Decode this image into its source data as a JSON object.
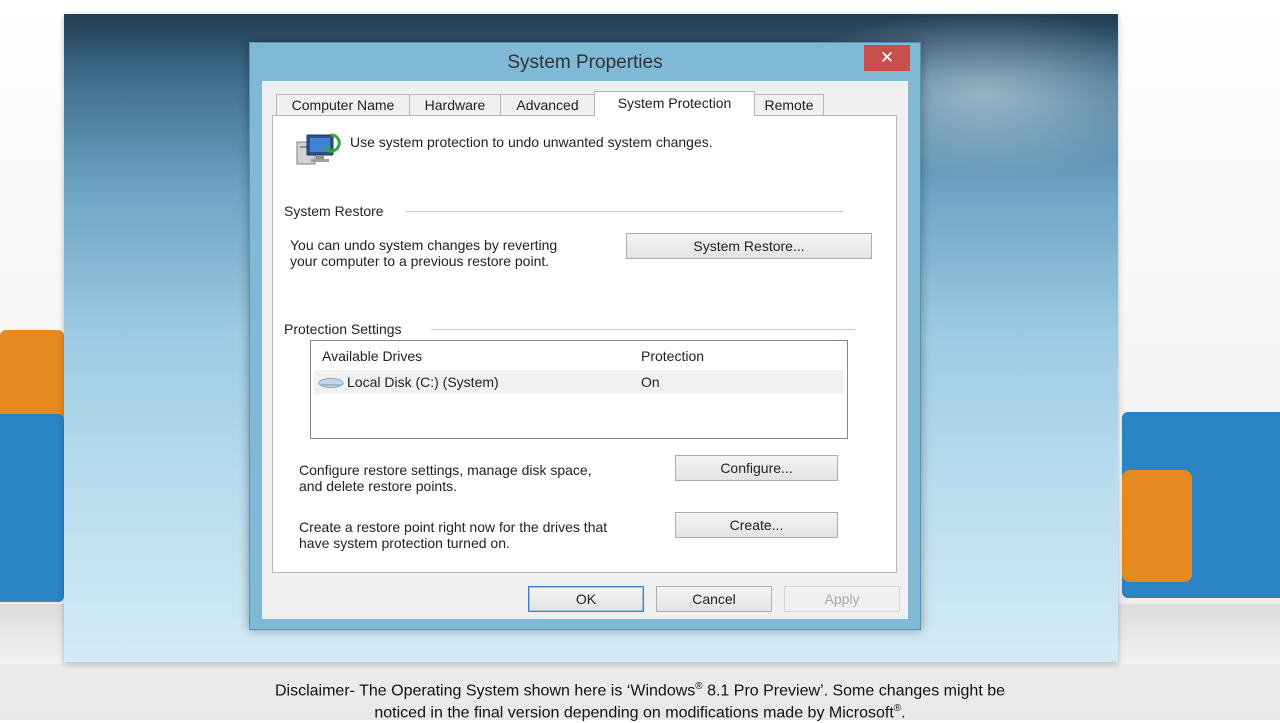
{
  "window": {
    "title": "System Properties",
    "close_glyph": "✕"
  },
  "tabs": [
    {
      "label": "Computer Name"
    },
    {
      "label": "Hardware"
    },
    {
      "label": "Advanced"
    },
    {
      "label": "System Protection",
      "active": true
    },
    {
      "label": "Remote"
    }
  ],
  "intro": {
    "icon": "system-protection-icon",
    "text": "Use system protection to undo unwanted system changes."
  },
  "system_restore": {
    "heading": "System Restore",
    "description_line1": "You can undo system changes by reverting",
    "description_line2": "your computer to a previous restore point.",
    "button_label": "System Restore..."
  },
  "protection_settings": {
    "heading": "Protection Settings",
    "columns": [
      "Available Drives",
      "Protection"
    ],
    "drives": [
      {
        "icon": "drive-icon",
        "name": "Local Disk (C:) (System)",
        "protection": "On"
      }
    ],
    "configure_line1": "Configure restore settings, manage disk space,",
    "configure_line2": "and delete restore points.",
    "configure_label": "Configure...",
    "create_line1": "Create a restore point right now for the drives that",
    "create_line2": "have system protection turned on.",
    "create_label": "Create..."
  },
  "footer": {
    "ok_label": "OK",
    "cancel_label": "Cancel",
    "apply_label": "Apply"
  },
  "disclaimer": {
    "line1_a": "Disclaimer- The Operating System shown here is ‘Windows",
    "reg": "®",
    "line1_b": " 8.1 Pro Preview’. Some changes might be",
    "line2": "noticed in the final version depending on modifications made by Microsoft",
    "line2_end": "."
  },
  "colors": {
    "accent": "#3d7bd0",
    "close": "#c7504a",
    "frame": "#7fb9d6"
  }
}
